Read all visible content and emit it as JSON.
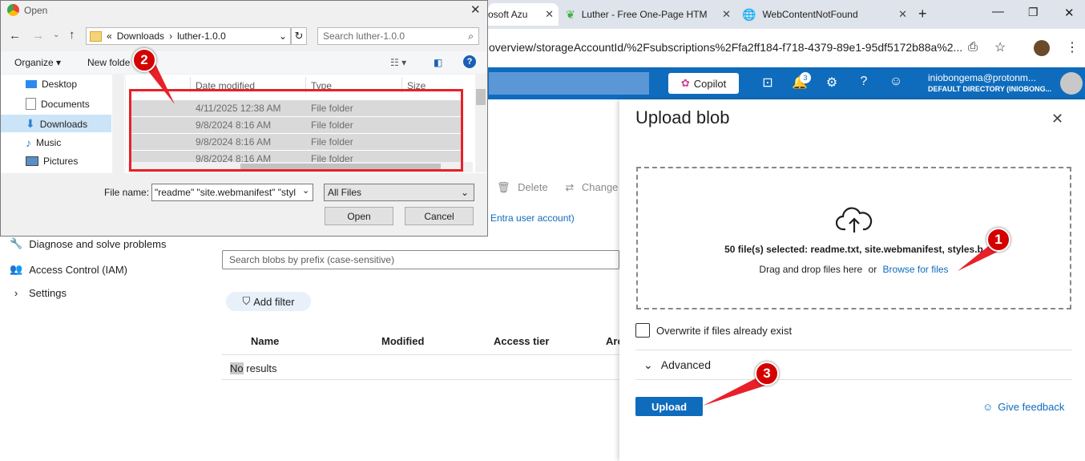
{
  "browser": {
    "tabs": [
      {
        "label": "osoft Azu"
      },
      {
        "label": "Luther - Free One-Page HTM"
      },
      {
        "label": "WebContentNotFound"
      }
    ],
    "url": "overview/storageAccountId/%2Fsubscriptions%2Ffa2ff184-f718-4379-89e1-95df5172b88a%2..."
  },
  "azure_header": {
    "copilot_label": "Copilot",
    "notification_count": "3",
    "user_email": "iniobongema@protonm...",
    "user_directory": "DEFAULT DIRECTORY (INIOBONG..."
  },
  "left_nav": [
    {
      "label": "Diagnose and solve problems"
    },
    {
      "label": "Access Control (IAM)"
    },
    {
      "label": "Settings"
    }
  ],
  "main": {
    "toolbar_delete": "Delete",
    "toolbar_change": "Change t",
    "entra_text": "Entra user account)",
    "search_placeholder": "Search blobs by prefix (case-sensitive)",
    "add_filter": "Add filter",
    "columns": [
      "Name",
      "Modified",
      "Access tier",
      "Arc"
    ],
    "no_results_a": "No",
    "no_results_b": " results"
  },
  "upload_panel": {
    "title": "Upload blob",
    "files_selected": "50 file(s) selected: readme.txt, site.webmanifest, styles.b",
    "drag_text": "Drag and drop files here",
    "or_text": "or",
    "browse_link": "Browse for files",
    "overwrite_label": "Overwrite if files already exist",
    "advanced_label": "Advanced",
    "upload_button": "Upload",
    "feedback_link": "Give feedback"
  },
  "open_dialog": {
    "title": "Open",
    "path_prefix": "«",
    "path_parts": [
      "Downloads",
      "luther-1.0.0"
    ],
    "search_placeholder": "Search luther-1.0.0",
    "organize": "Organize",
    "new_folder": "New folde",
    "nav_items": [
      {
        "label": "Desktop"
      },
      {
        "label": "Documents"
      },
      {
        "label": "Downloads"
      },
      {
        "label": "Music"
      },
      {
        "label": "Pictures"
      }
    ],
    "columns": [
      "Date modified",
      "Type",
      "Size"
    ],
    "rows": [
      {
        "date": "4/11/2025 12:38 AM",
        "type": "File folder"
      },
      {
        "date": "9/8/2024 8:16 AM",
        "type": "File folder"
      },
      {
        "date": "9/8/2024 8:16 AM",
        "type": "File folder"
      },
      {
        "date": "9/8/2024 8:16 AM",
        "type": "File folder"
      }
    ],
    "file_name_label": "File name:",
    "file_name_value": "\"readme\" \"site.webmanifest\" \"styl",
    "file_type": "All Files",
    "open_button": "Open",
    "cancel_button": "Cancel"
  },
  "annotations": {
    "badge1": "1",
    "badge2": "2",
    "badge3": "3",
    "color": "#d40000"
  }
}
